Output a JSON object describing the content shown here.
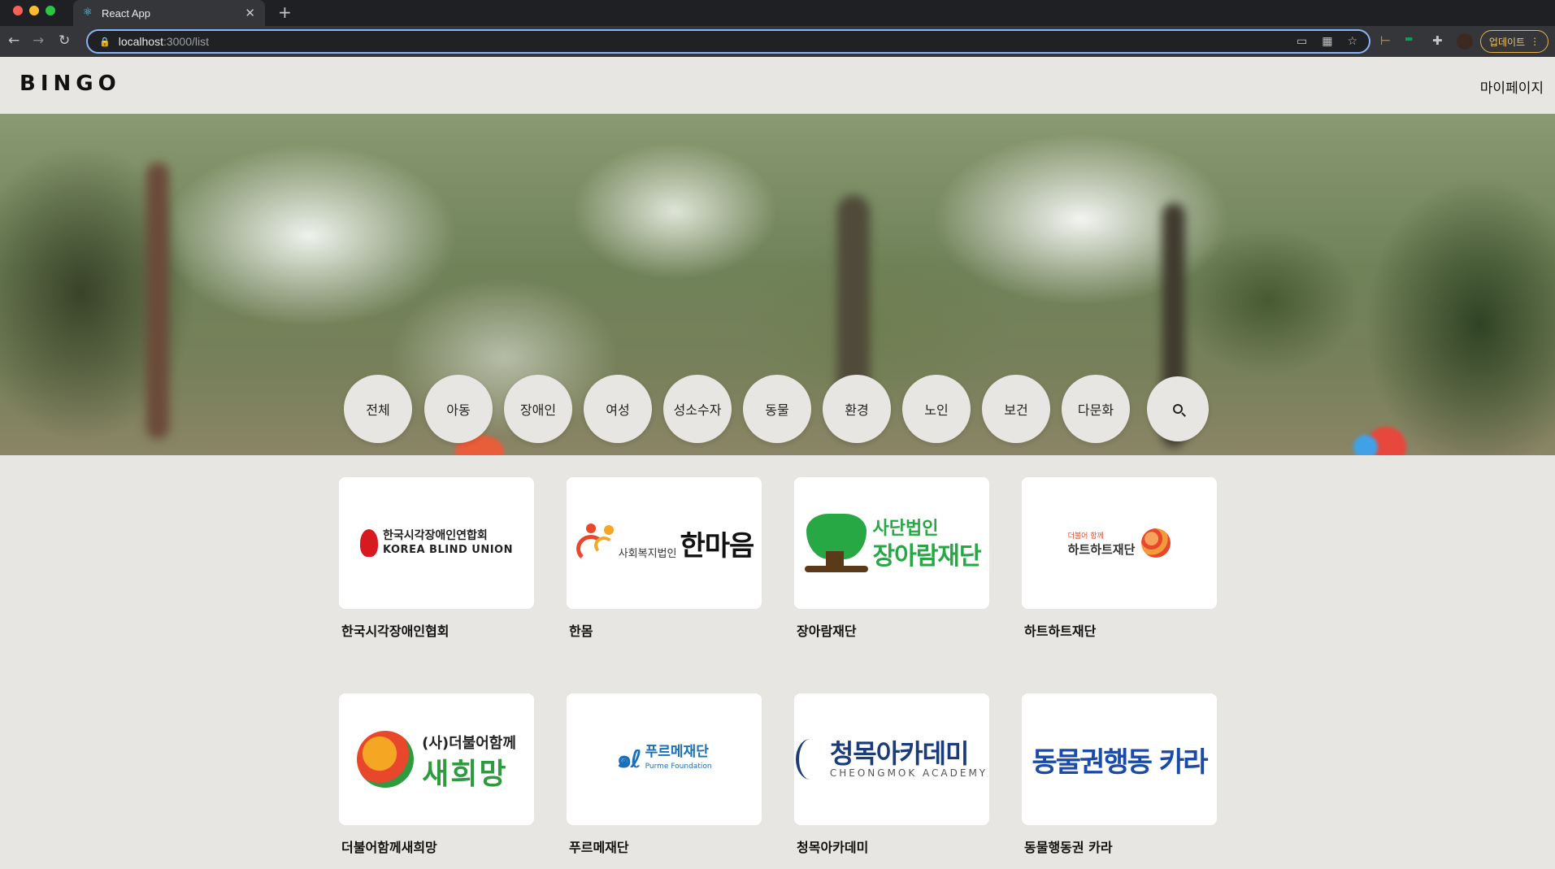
{
  "browser": {
    "tab_title": "React App",
    "url_host": "localhost",
    "url_path": ":3000/list",
    "update_label": "업데이트"
  },
  "header": {
    "logo": "BINGO",
    "mypage": "마이페이지"
  },
  "categories": [
    "전체",
    "아동",
    "장애인",
    "여성",
    "성소수자",
    "동물",
    "환경",
    "노인",
    "보건",
    "다문화"
  ],
  "cards": [
    {
      "name": "한국시각장애인협회",
      "logo_ko": "한국시각장애인연합회",
      "logo_en": "KOREA BLIND UNION"
    },
    {
      "name": "한몸",
      "logo_sub": "사회복지법인",
      "logo_main": "한마음"
    },
    {
      "name": "장아람재단",
      "logo_sub": "사단법인",
      "logo_main": "장아람재단"
    },
    {
      "name": "하트하트재단",
      "logo_sub": "더불어 함께",
      "logo_main": "하트하트재단"
    },
    {
      "name": "더불어함께새희망",
      "logo_sub": "(사)더불어함께",
      "logo_main": "새희망"
    },
    {
      "name": "푸르메재단",
      "logo_main": "푸르메재단",
      "logo_en": "Purme Foundation"
    },
    {
      "name": "청목아카데미",
      "logo_main": "청목아카데미",
      "logo_en": "CHEONGMOK ACADEMY"
    },
    {
      "name": "동물행동권 카라",
      "logo_main": "동물권행동",
      "logo_bold": "카라"
    }
  ],
  "colors": {
    "page_bg": "#e8e6e2",
    "accent_green": "#27a844",
    "accent_blue": "#1b4aa8"
  }
}
